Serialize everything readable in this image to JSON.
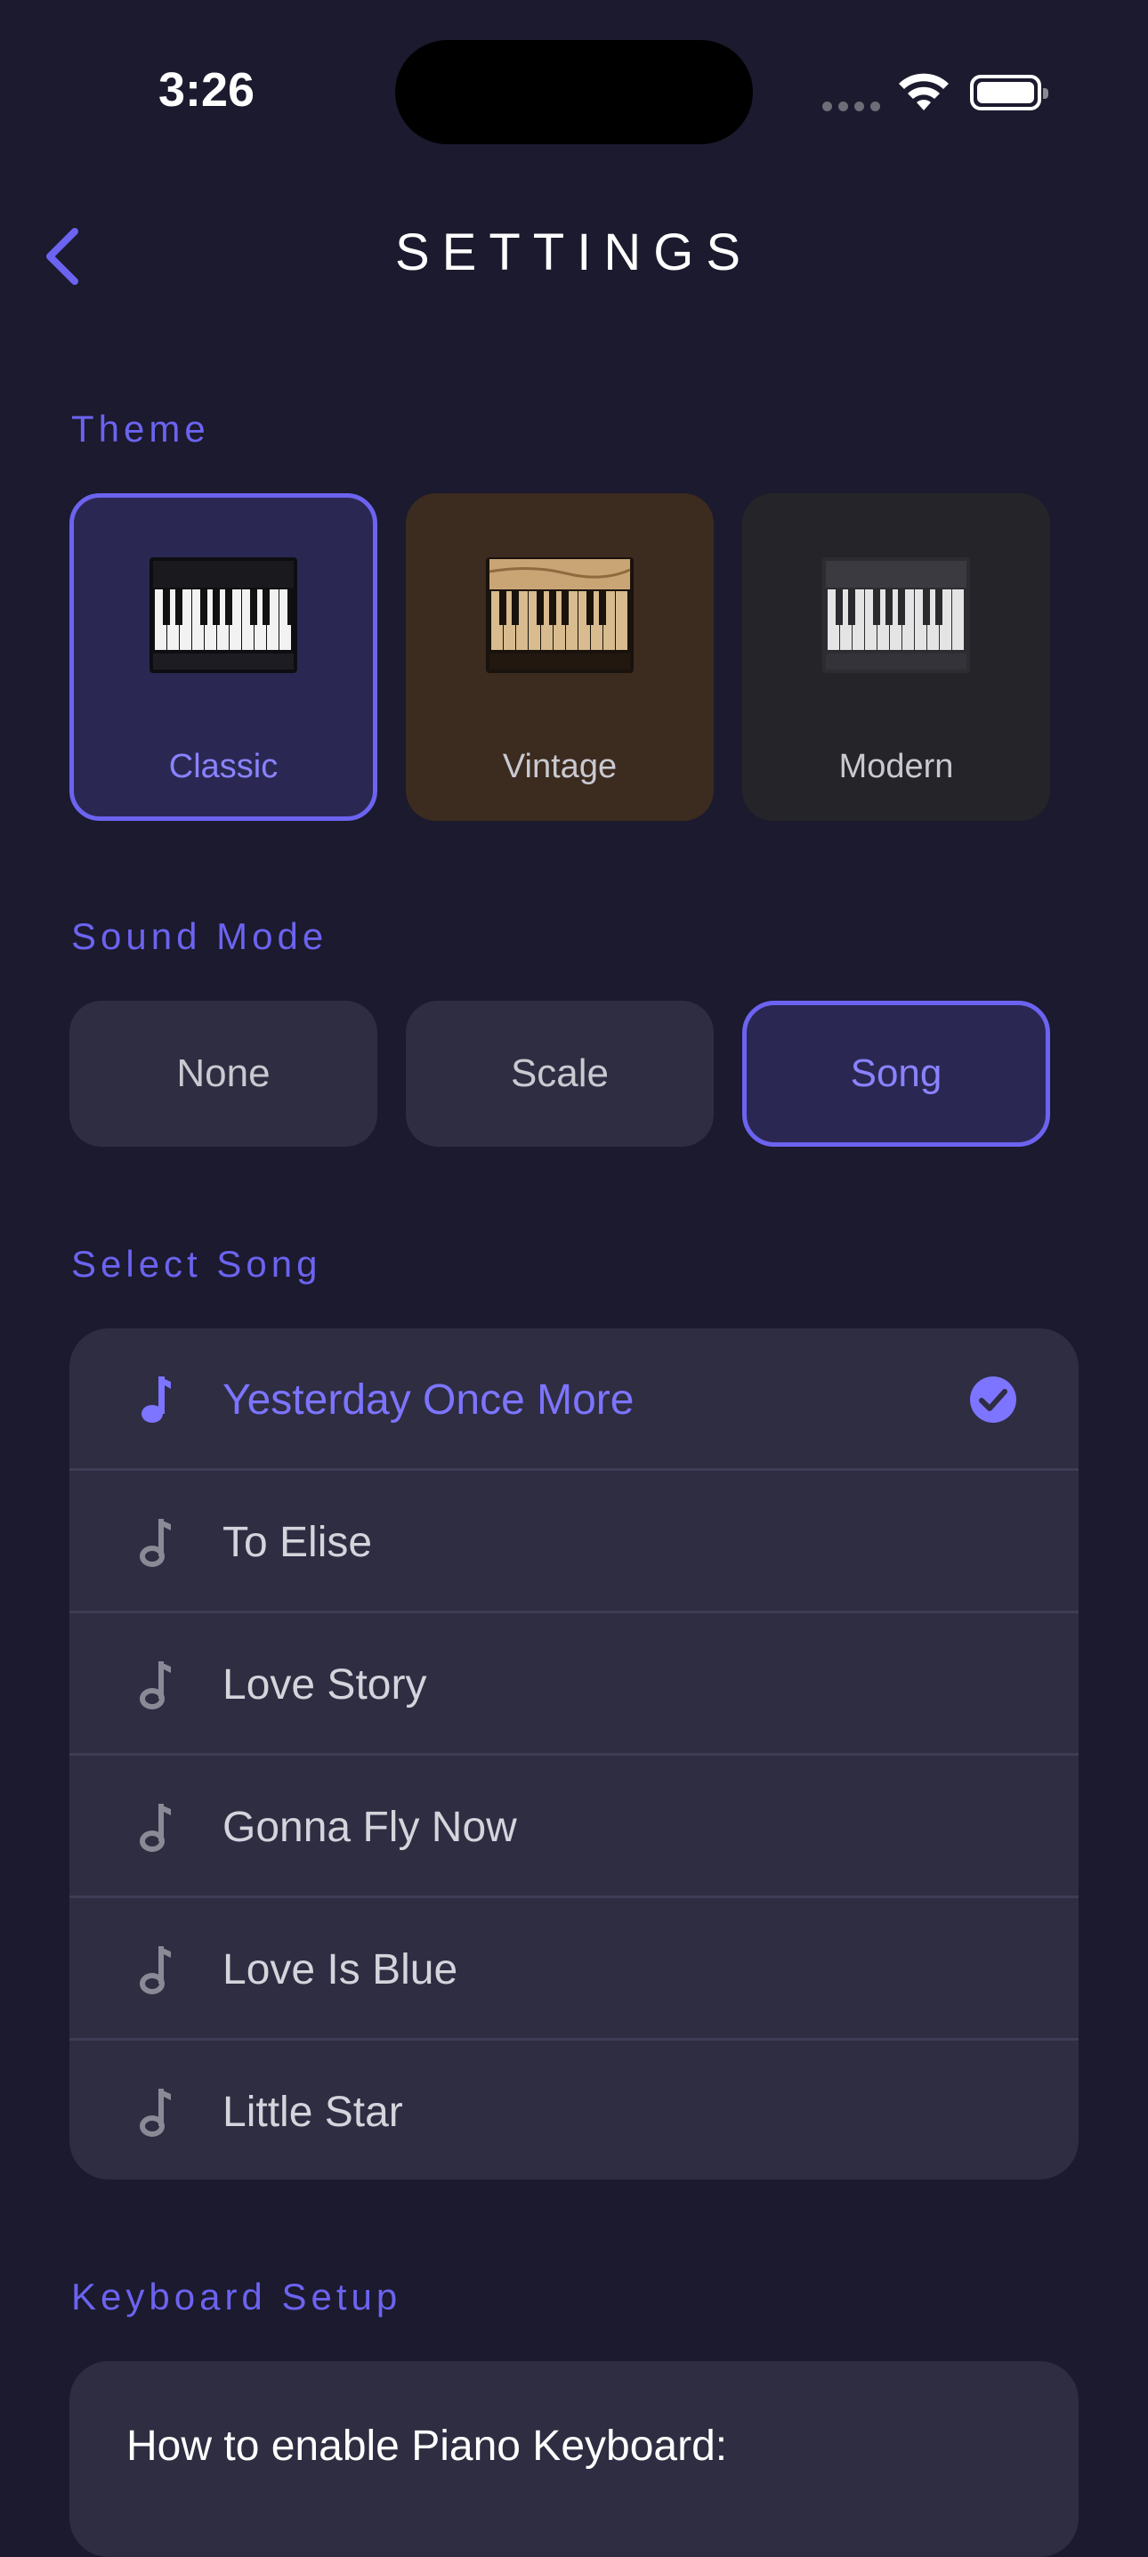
{
  "status_bar": {
    "time": "3:26"
  },
  "header": {
    "title": "SETTINGS",
    "back_icon": "chevron-left-icon"
  },
  "theme": {
    "label": "Theme",
    "options": [
      {
        "name": "Classic",
        "selected": true
      },
      {
        "name": "Vintage",
        "selected": false
      },
      {
        "name": "Modern",
        "selected": false
      }
    ]
  },
  "sound_mode": {
    "label": "Sound Mode",
    "options": [
      {
        "name": "None",
        "selected": false
      },
      {
        "name": "Scale",
        "selected": false
      },
      {
        "name": "Song",
        "selected": true
      }
    ]
  },
  "select_song": {
    "label": "Select Song",
    "songs": [
      {
        "title": "Yesterday Once More",
        "selected": true
      },
      {
        "title": "To Elise",
        "selected": false
      },
      {
        "title": "Love Story",
        "selected": false
      },
      {
        "title": "Gonna Fly Now",
        "selected": false
      },
      {
        "title": "Love Is Blue",
        "selected": false
      },
      {
        "title": "Little Star",
        "selected": false
      }
    ]
  },
  "keyboard_setup": {
    "label": "Keyboard Setup",
    "card_title": "How to enable Piano Keyboard:"
  },
  "colors": {
    "background": "#1b1a2e",
    "accent": "#6c63f0",
    "card": "#2e2d42",
    "selected_card": "#2a2852"
  }
}
